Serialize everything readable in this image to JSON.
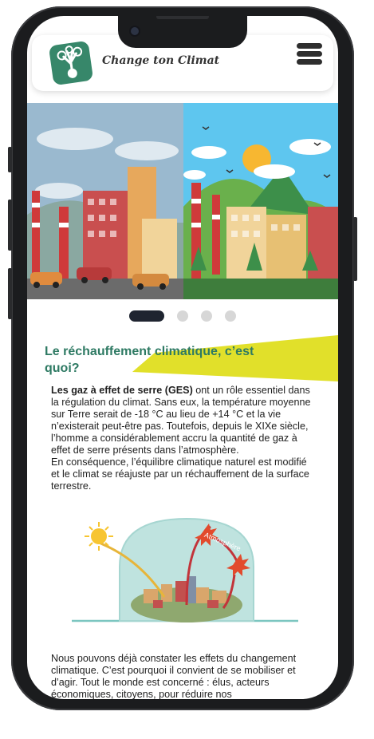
{
  "brand": {
    "name": "Change ton Climat",
    "logo_icon": "tree-hand-icon"
  },
  "menu": {
    "icon": "hamburger-menu-icon"
  },
  "carousel": {
    "slides": 4,
    "active_index": 0
  },
  "section": {
    "title": "Le réchauffement climatique, c’est quoi?",
    "paragraph_bold": "Les gaz à effet de serre (GES)",
    "paragraph_rest": " ont un rôle essentiel dans la régulation du climat. Sans eux, la température moyenne sur Terre serait de -18 °C au lieu de +14 °C et la vie n’existerait peut-être pas. Toutefois, depuis le XIXe siècle, l’homme a considérablement accru la quantité de gaz à effet de serre présents dans l’atmosphère.",
    "paragraph2": "En conséquence, l’équilibre climatique naturel est modifié et le climat se réajuste par un réchauffement de la surface terrestre.",
    "illustration_label": "Atmosphère",
    "paragraph3": "Nous pouvons déjà constater les effets du changement climatique. C’est pourquoi il convient de se mobiliser et d’agir. Tout le monde est concerné : élus, acteurs économiques, citoyens, pour réduire nos"
  },
  "colors": {
    "accent_green": "#2e7a63",
    "banner_yellow": "#e1e02a",
    "logo_green": "#37876a",
    "sky_blue": "#5ec6ef"
  }
}
